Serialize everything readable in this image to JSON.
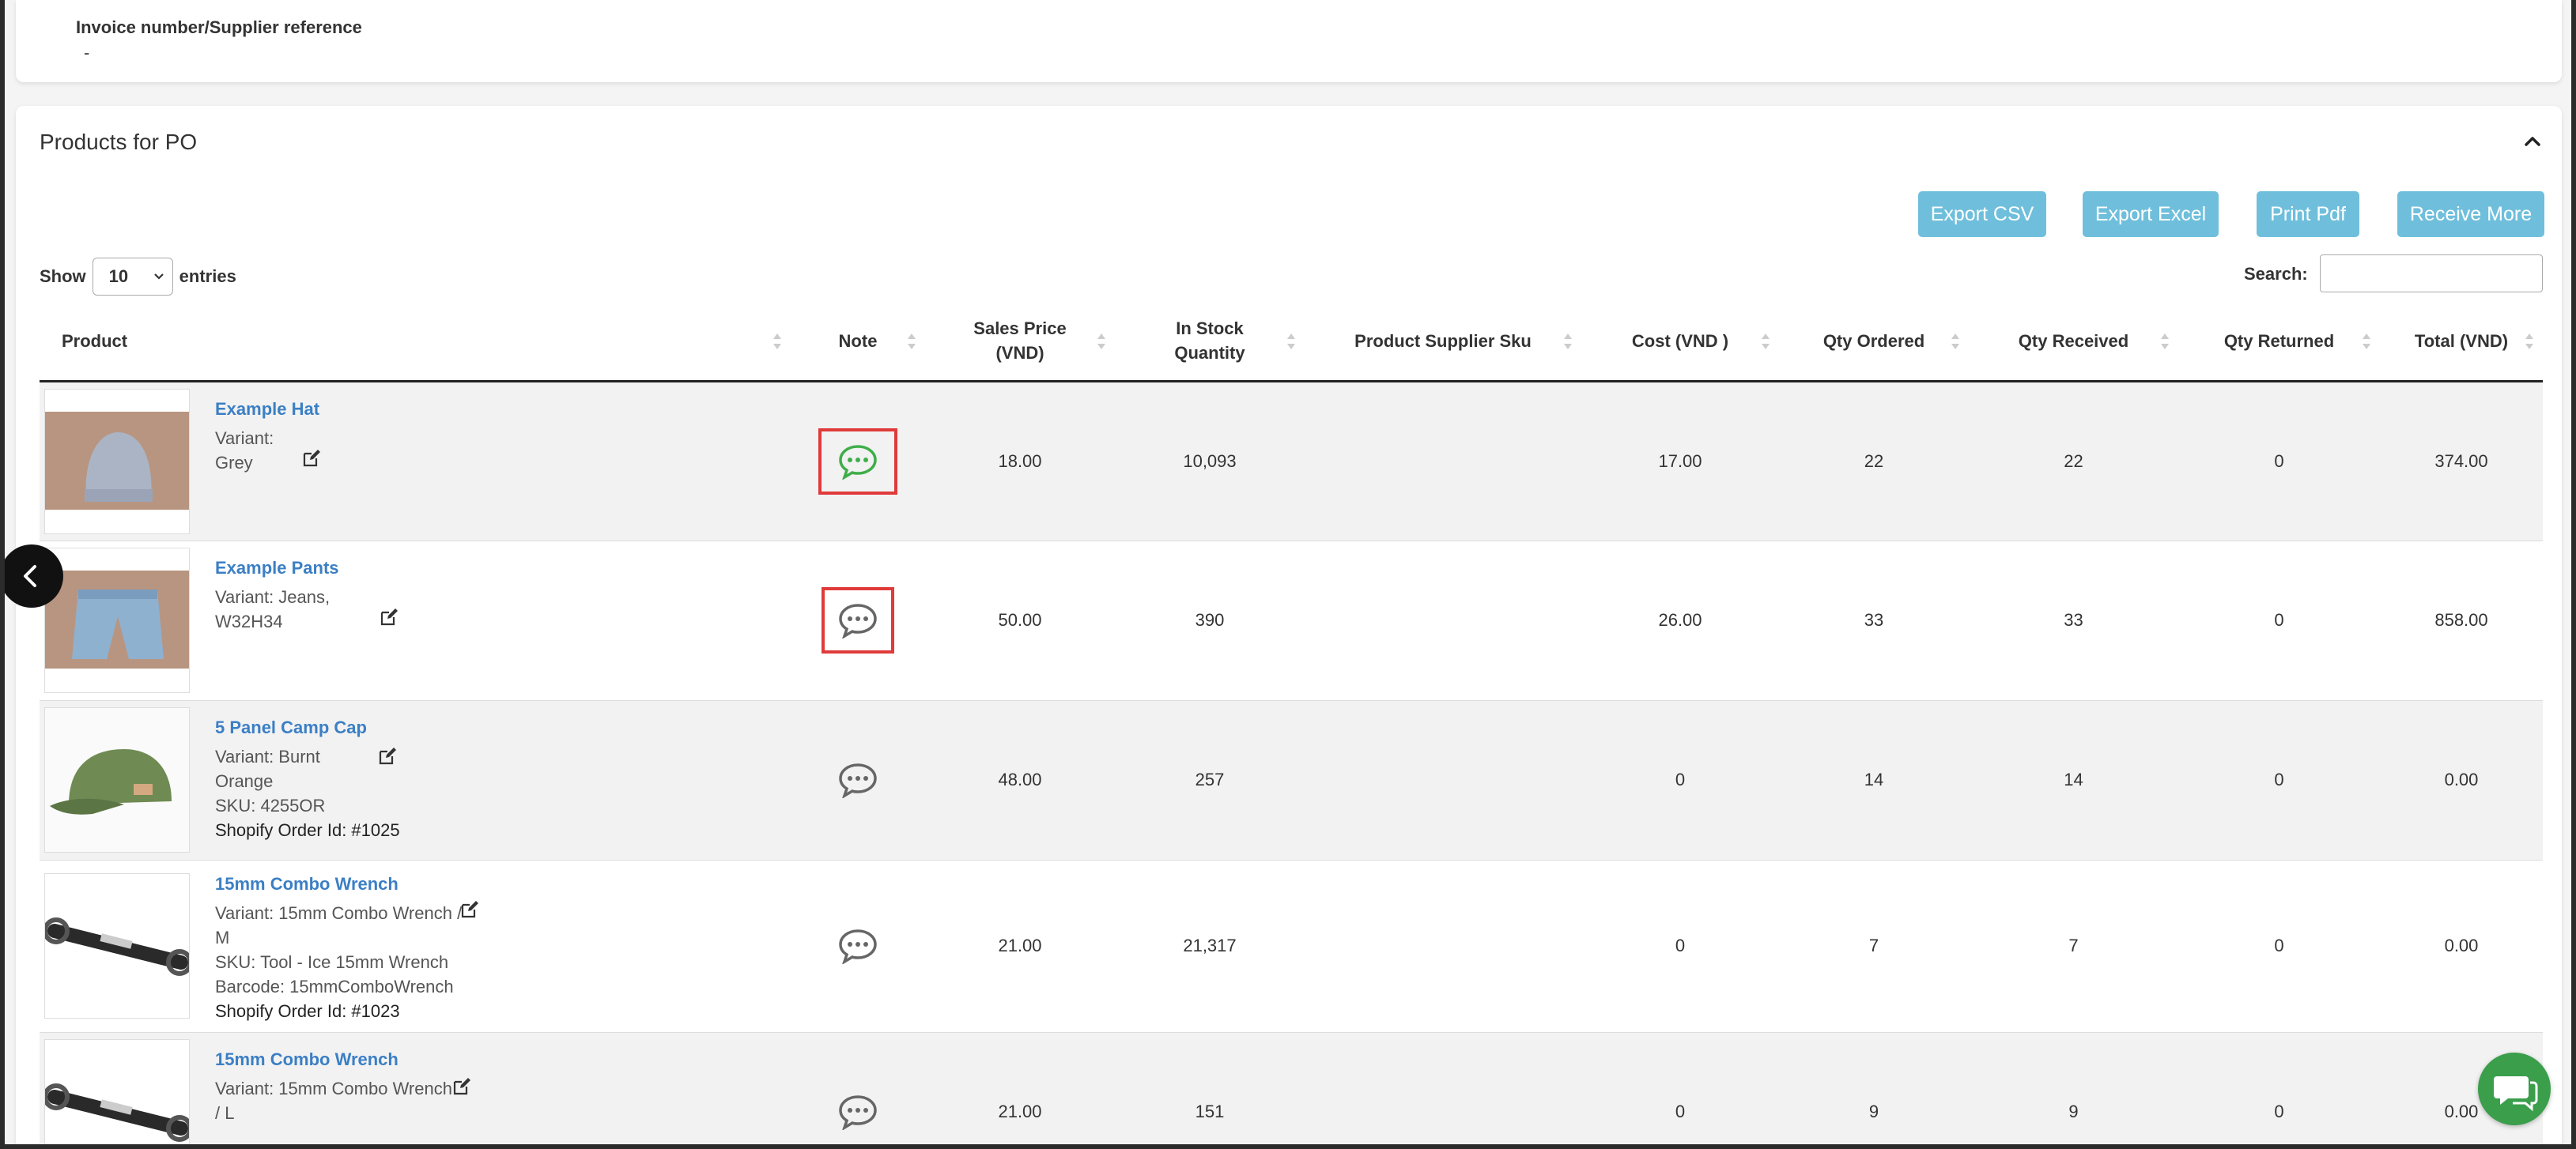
{
  "invoice": {
    "label": "Invoice number/Supplier reference",
    "value": "-"
  },
  "products": {
    "title": "Products for PO",
    "buttons": {
      "export_csv": "Export CSV",
      "export_excel": "Export Excel",
      "print_pdf": "Print Pdf",
      "receive_more": "Receive More"
    },
    "show_label": "Show",
    "entries_value": "10",
    "entries_label": "entries",
    "search_label": "Search:",
    "search_value": "",
    "columns": {
      "product": "Product",
      "note": "Note",
      "sales_price_1": "Sales Price",
      "sales_price_2": "(VND)",
      "in_stock_1": "In Stock",
      "in_stock_2": "Quantity",
      "supplier_sku": "Product Supplier Sku",
      "cost": "Cost (VND )",
      "qty_ordered": "Qty Ordered",
      "qty_received": "Qty Received",
      "qty_returned": "Qty Returned",
      "total": "Total (VND)"
    },
    "rows": [
      {
        "name": "Example Hat",
        "variant_1": "Variant:",
        "variant_2": "Grey",
        "sales_price": "18.00",
        "in_stock": "10,093",
        "supplier_sku": "",
        "cost": "17.00",
        "qty_ordered": "22",
        "qty_received": "22",
        "qty_returned": "0",
        "total": "374.00",
        "note_color": "#3fae49"
      },
      {
        "name": "Example Pants",
        "variant_1": "Variant: Jeans,",
        "variant_2": "W32H34",
        "sales_price": "50.00",
        "in_stock": "390",
        "supplier_sku": "",
        "cost": "26.00",
        "qty_ordered": "33",
        "qty_received": "33",
        "qty_returned": "0",
        "total": "858.00",
        "note_color": "#666666"
      },
      {
        "name": "5 Panel Camp Cap",
        "variant_1": "Variant: Burnt",
        "variant_2": "Orange",
        "sku": "SKU: 4255OR",
        "order_id": "Shopify Order Id: #1025",
        "sales_price": "48.00",
        "in_stock": "257",
        "supplier_sku": "",
        "cost": "0",
        "qty_ordered": "14",
        "qty_received": "14",
        "qty_returned": "0",
        "total": "0.00",
        "note_color": "#666666"
      },
      {
        "name": "15mm Combo Wrench",
        "variant_1": "Variant: 15mm Combo Wrench /",
        "variant_2": "M",
        "sku": "SKU: Tool - Ice 15mm Wrench",
        "barcode": "Barcode: 15mmComboWrench",
        "order_id": "Shopify Order Id: #1023",
        "sales_price": "21.00",
        "in_stock": "21,317",
        "supplier_sku": "",
        "cost": "0",
        "qty_ordered": "7",
        "qty_received": "7",
        "qty_returned": "0",
        "total": "0.00",
        "note_color": "#666666"
      },
      {
        "name": "15mm Combo Wrench",
        "variant_1": "Variant: 15mm Combo Wrench",
        "variant_2": "/ L",
        "sales_price": "21.00",
        "in_stock": "151",
        "supplier_sku": "",
        "cost": "0",
        "qty_ordered": "9",
        "qty_received": "9",
        "qty_returned": "0",
        "total": "0.00",
        "note_color": "#666666"
      }
    ]
  },
  "colors": {
    "link": "#3b7fc4",
    "button": "#6fbfdc",
    "highlight_border": "#e03a3a",
    "chat": "#3a9e4b"
  }
}
